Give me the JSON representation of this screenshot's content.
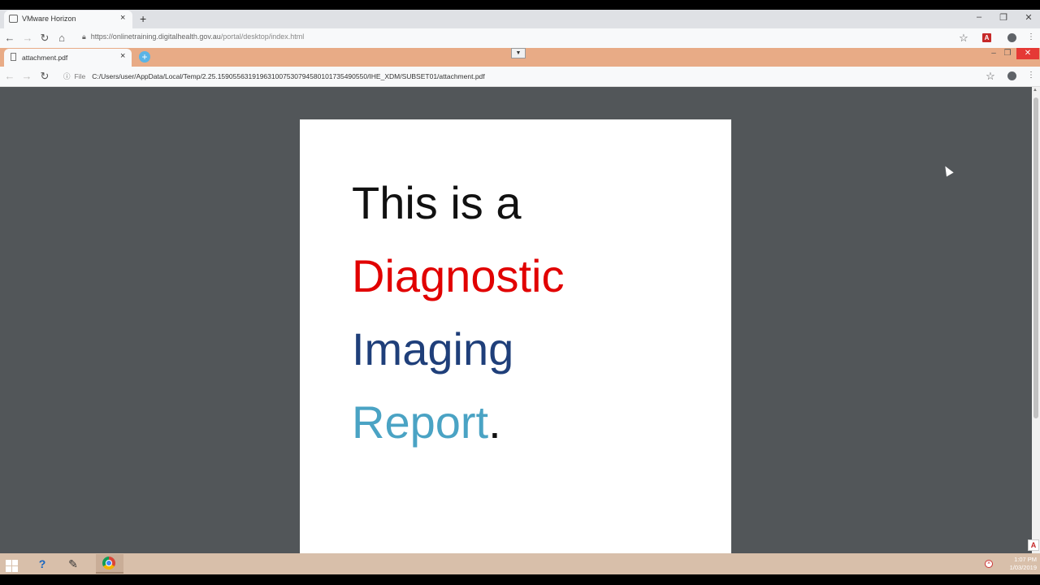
{
  "outer_browser": {
    "tab_title": "VMware Horizon",
    "tab_close": "×",
    "new_tab": "+",
    "url_secure_icon": "lock-icon",
    "url_domain": "https://onlinetraining.digitalhealth.gov.au",
    "url_path": "/portal/desktop/index.html",
    "window_controls": {
      "minimize": "–",
      "restore": "❐",
      "close": "✕"
    },
    "nav": {
      "back": "←",
      "forward": "→",
      "reload": "↻",
      "home": "⌂"
    },
    "bookmark": "☆",
    "acrobat": "A",
    "menu": "⋮"
  },
  "inner_browser": {
    "tab_title": "attachment.pdf",
    "tab_close": "×",
    "new_tab": "+",
    "vm_dropdown": "▼",
    "url_scheme_label": "File",
    "url_info_icon": "ⓘ",
    "url_path": "C:/Users/user/AppData/Local/Temp/2.25.159055631919631007530794580101735490550/IHE_XDM/SUBSET01/attachment.pdf",
    "window_controls": {
      "minimize": "–",
      "restore": "❐",
      "close": "✕"
    },
    "nav": {
      "back": "←",
      "forward": "→",
      "reload": "↻"
    },
    "bookmark": "☆",
    "menu": "⋮"
  },
  "pdf": {
    "line1": "This is a",
    "line2": "Diagnostic",
    "line3": "Imaging",
    "line4_word": "Report",
    "line4_punct": ".",
    "colors": {
      "line1": "#111111",
      "line2": "#e10000",
      "line3": "#1f3f7a",
      "line4": "#4aa3c4"
    }
  },
  "scrollbar": {
    "up_arrow": "▲",
    "acrobat": "A"
  },
  "taskbar": {
    "help_icon": "?",
    "pen_icon": "✎",
    "clock_time": "1:07 PM",
    "clock_date": "1/03/2019",
    "tray_icon": "×"
  }
}
